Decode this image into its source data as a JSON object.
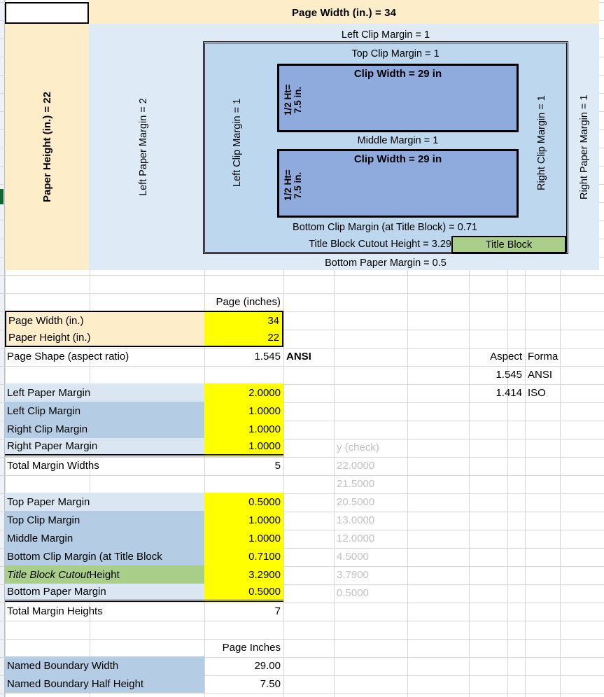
{
  "diagram": {
    "page_width_label": "Page Width (in.) = 34",
    "paper_height_label": "Paper Height (in.) = 22",
    "left_paper_margin_label": "Left Paper Margin = 2",
    "right_paper_margin_label": "Right Paper Margin = 1",
    "left_clip_margin_top_label": "Left Clip Margin = 1",
    "left_clip_margin_vertical_label": "Left Clip Margin = 1",
    "right_clip_margin_vertical_label": "Right Clip Margin = 1",
    "top_clip_margin_label": "Top Clip Margin = 1",
    "middle_margin_label": "Middle Margin = 1",
    "bottom_clip_margin_label": "Bottom Clip Margin (at Title Block) = 0.71",
    "title_block_cutout_label": "Title Block Cutout Height = 3.29",
    "title_block_label": "Title Block",
    "bottom_paper_margin_label": "Bottom Paper Margin = 0.5",
    "clip_top": {
      "half_height_label": "1/2 Ht=\n7.5 in.",
      "clip_width_label": "Clip Width = 29 in"
    },
    "clip_bottom": {
      "half_height_label": "1/2 Ht=\n7.5 in.",
      "clip_width_label": "Clip Width = 29 in"
    }
  },
  "colors": {
    "paper_area": "#deeaf6",
    "clip_area": "#bdd7ee",
    "clip_rect": "#8faadc",
    "cream": "#fdeec9",
    "yellow_input": "#ffff00",
    "green_title_block": "#a9ce89",
    "blue_light": "#dae6f2",
    "blue_medium": "#b4cce4",
    "grey_text": "#c2c2c2"
  },
  "sheet": {
    "header_page_inches": "Page (inches)",
    "header_page_inches_2": "Page Inches",
    "header_aspect": "Aspect",
    "header_format": "Forma",
    "header_ycheck": "y (check)",
    "rows": [
      {
        "label": "Page Width (in.)",
        "value": "34"
      },
      {
        "label": "Paper Height (in.)",
        "value": "22"
      },
      {
        "label": "Page Shape (aspect ratio)",
        "value": "1.545",
        "note": "ANSI"
      },
      {
        "label": "Left Paper Margin",
        "value": "2.0000"
      },
      {
        "label": "Left Clip Margin",
        "value": "1.0000"
      },
      {
        "label": "Right Clip Margin",
        "value": "1.0000"
      },
      {
        "label": "Right Paper Margin",
        "value": "1.0000"
      },
      {
        "label": "Total Margin Widths",
        "value": "5"
      },
      {
        "label": "Top Paper Margin",
        "value": "0.5000"
      },
      {
        "label": "Top Clip Margin",
        "value": "1.0000"
      },
      {
        "label": "Middle Margin",
        "value": "1.0000"
      },
      {
        "label": "Bottom Clip Margin (at Title Block",
        "value": "0.7100"
      },
      {
        "label": "Title Block Cutout Height",
        "value": "3.2900"
      },
      {
        "label": "Bottom Paper Margin",
        "value": "0.5000"
      },
      {
        "label": "Total Margin Heights",
        "value": "7"
      },
      {
        "label": "Named Boundary Width",
        "value": "29.00"
      },
      {
        "label": "Named Boundary Half Height",
        "value": "7.50"
      }
    ],
    "title_block_cutout_italic": "Title Block Cutout",
    "title_block_cutout_rest": " Height",
    "aspect_table": [
      {
        "aspect": "1.545",
        "format": "ANSI"
      },
      {
        "aspect": "1.414",
        "format": "ISO"
      }
    ],
    "ycheck_values": [
      "22.0000",
      "21.5000",
      "20.5000",
      "13.0000",
      "12.0000",
      "4.5000",
      "3.7900",
      "0.5000"
    ]
  }
}
